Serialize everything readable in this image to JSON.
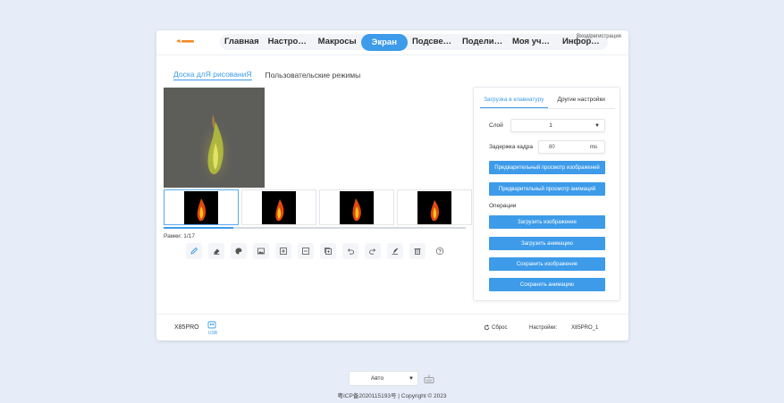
{
  "header": {
    "logo": "logo-icon",
    "nav": [
      {
        "label": "Главная"
      },
      {
        "label": "Настройки"
      },
      {
        "label": "Макросы"
      },
      {
        "label": "Экран",
        "active": true
      },
      {
        "label": "Подсветка"
      },
      {
        "label": "Поделиться"
      },
      {
        "label": "Моя учетная запись"
      },
      {
        "label": "Информация"
      }
    ],
    "login_label": "Вход/регистрация"
  },
  "subtabs": {
    "draw_board": "Доска длЯ рисованиЯ",
    "custom_modes": "Пользовательские режимы"
  },
  "editor": {
    "frame_count": "Рамки: 1/17",
    "progress": 0.23,
    "tools": [
      "pencil-icon",
      "eraser-icon",
      "palette-icon",
      "image-icon",
      "add-frame-icon",
      "remove-frame-icon",
      "copy-frame-icon",
      "undo-icon",
      "redo-icon",
      "fill-icon",
      "trash-icon",
      "help-icon"
    ]
  },
  "panel": {
    "tab_upload": "Загрузка в клавиатуру",
    "tab_other": "Другие настройки",
    "layer_label": "Слой",
    "layer_value": "1",
    "delay_label": "Задержка кадра",
    "delay_value": "80",
    "delay_unit": "ms",
    "btn_preview_images": "Предварительный просмотр изображений",
    "btn_preview_anim": "Предварительный просмотр анимаций",
    "operations_label": "Операции",
    "btn_load_image": "Загрузить изображение",
    "btn_load_anim": "Загрузить анимацию",
    "btn_save_image": "Сохранить изображение",
    "btn_save_anim": "Сохранить анимацию"
  },
  "footer": {
    "model": "X85PRO",
    "usb_label": "USB",
    "reset_label": "Сброс",
    "settings_label": "Настройки:",
    "settings_value": "X85PRO_1"
  },
  "bottom": {
    "mode_value": "Авто",
    "copyright": "粤ICP备2020115193号 | Copyright © 2023"
  },
  "colors": {
    "accent": "#3d9be9",
    "background": "#e6edf8"
  }
}
